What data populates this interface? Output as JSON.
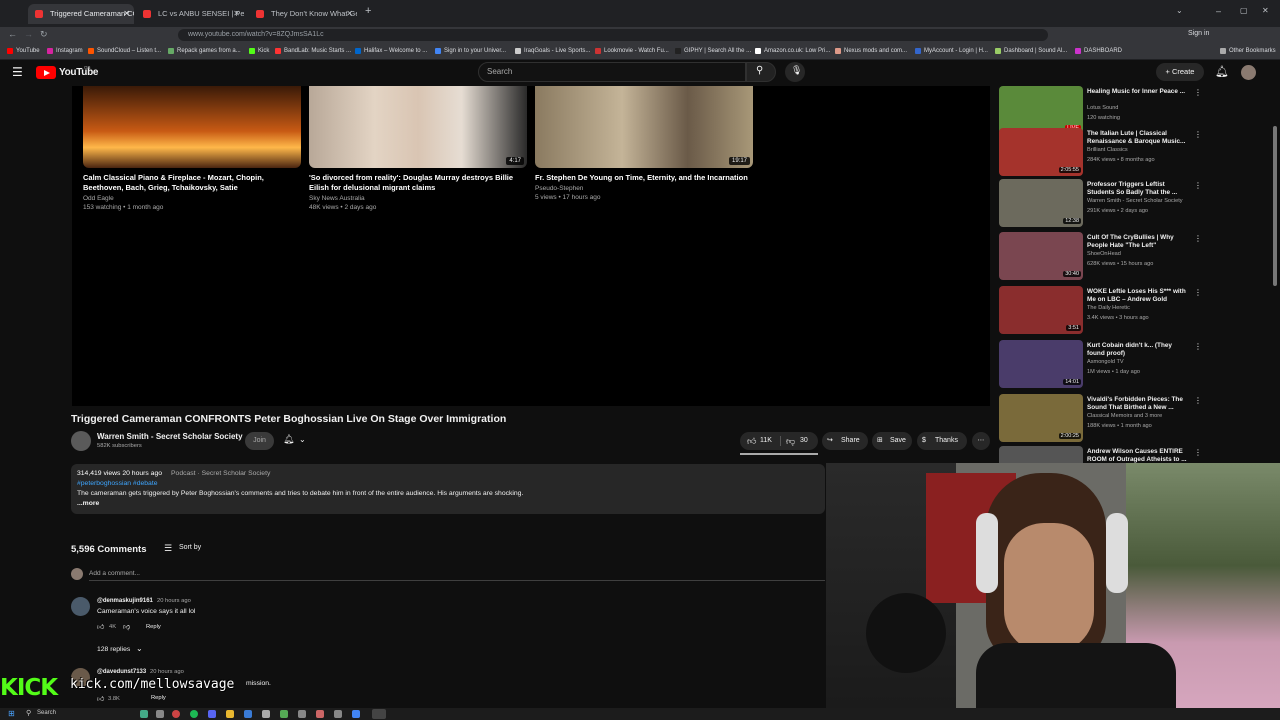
{
  "browser": {
    "tabs": [
      {
        "title": "Triggered Cameraman CONFRONTS"
      },
      {
        "title": "LC vs ANBU SENSEI | PenGam"
      },
      {
        "title": "They Don't Know What Genre V"
      }
    ],
    "new_tab": "+",
    "url": "www.youtube.com/watch?v=8ZQJmsSA1Lc",
    "signin": "Sign in",
    "bookmarks": [
      "YouTube",
      "Instagram",
      "SoundCloud – Listen t...",
      "Repack games from a...",
      "Kick",
      "BandLab: Music Starts ...",
      "Halifax – Welcome to ...",
      "Sign in to your Univer...",
      "IraqGoals - Live Sports...",
      "Lookmovie - Watch Fu...",
      "GIPHY | Search All the ...",
      "Amazon.co.uk: Low Pri...",
      "Nexus mods and com...",
      "MyAccount - Login | H...",
      "Dashboard | Sound Al...",
      "DASHBOARD"
    ],
    "other_bookmarks": "Other Bookmarks"
  },
  "youtube": {
    "logo_text": "YouTube",
    "logo_sup": "GB",
    "search_placeholder": "Search",
    "create_label": "Create"
  },
  "endscreen": [
    {
      "title": "Calm Classical Piano & Fireplace - Mozart, Chopin, Beethoven, Bach, Grieg, Tchaikovsky, Satie",
      "channel": "Odd Eagle",
      "meta": "153 watching • 1 month ago",
      "duration": ""
    },
    {
      "title": "'So divorced from reality': Douglas Murray destroys Billie Eilish for delusional migrant claims",
      "channel": "Sky News Australia",
      "meta": "48K views • 2 days ago",
      "duration": "4:17"
    },
    {
      "title": "Fr. Stephen De Young on Time, Eternity, and the Incarnation",
      "channel": "Pseudo-Stephen",
      "meta": "5 views • 17 hours ago",
      "duration": "19:17"
    }
  ],
  "video": {
    "title": "Triggered Cameraman CONFRONTS Peter Boghossian Live On Stage Over Immigration",
    "channel": "Warren Smith - Secret Scholar Society",
    "subscribers": "582K subscribers",
    "join": "Join",
    "likes": "11K",
    "dislikes": "30",
    "share": "Share",
    "save": "Save",
    "thanks": "Thanks",
    "views_date": "314,419 views  20 hours ago",
    "podcast": "Podcast · Secret Scholar Society",
    "hashtags": "#peterboghossian #debate",
    "description": "The cameraman gets triggered by Peter Boghossian's comments and tries to debate him in front of the entire audience. His arguments are shocking.",
    "more": "...more"
  },
  "comments": {
    "count": "5,596 Comments",
    "sort": "Sort by",
    "add_placeholder": "Add a comment...",
    "items": [
      {
        "user": "@denmaskujin9161",
        "time": "20 hours ago",
        "text": "Cameraman's voice says it all lol",
        "likes": "4K",
        "reply": "Reply",
        "replies": "128 replies"
      },
      {
        "user": "@davedunst7133",
        "time": "20 hours ago",
        "text": "mission.",
        "likes": "3.8K",
        "reply": "Reply"
      }
    ]
  },
  "related": [
    {
      "title": "Healing Music for Inner Peace ...",
      "channel": "Lotus Sound",
      "meta": "120 watching",
      "duration": "LIVE",
      "color": "#5a8a3a"
    },
    {
      "title": "The Italian Lute | Classical Renaissance & Baroque Music...",
      "channel": "Brilliant Classics",
      "meta": "284K views • 8 months ago",
      "duration": "2:05:55",
      "color": "#a5332c"
    },
    {
      "title": "Professor Triggers Leftist Students So Badly That the ...",
      "channel": "Warren Smith - Secret Scholar Society",
      "meta": "291K views • 2 days ago",
      "duration": "12:38",
      "color": "#6c6a5d"
    },
    {
      "title": "Cult Of The CryBullies | Why People Hate \"The Left\"",
      "channel": "ShoeOnHead",
      "meta": "628K views • 15 hours ago",
      "duration": "30:40",
      "color": "#7a4650"
    },
    {
      "title": "WOKE Leftie Loses His S*** with Me on LBC – Andrew Gold",
      "channel": "The Daily Heretic",
      "meta": "3.4K views • 3 hours ago",
      "duration": "3:51",
      "color": "#8a2d2d"
    },
    {
      "title": "Kurt Cobain didn't k... (They found proof)",
      "channel": "Asmongold TV",
      "meta": "1M views • 1 day ago",
      "duration": "14:01",
      "color": "#4a3c6a"
    },
    {
      "title": "Vivaldi's Forbidden Pieces: The Sound That Birthed a New ...",
      "channel": "Classical Memoirs and 3 more",
      "meta": "188K views • 1 month ago",
      "duration": "2:00:25",
      "color": "#7a6a3a"
    },
    {
      "title": "Andrew Wilson Causes ENTIRE ROOM of Outraged Atheists to ...",
      "channel": "",
      "meta": "",
      "duration": "",
      "color": "#555"
    }
  ],
  "overlay": {
    "kick_logo": "KICK",
    "kick_url": "kick.com/mellowsavage"
  },
  "taskbar": {
    "search": "Search"
  }
}
